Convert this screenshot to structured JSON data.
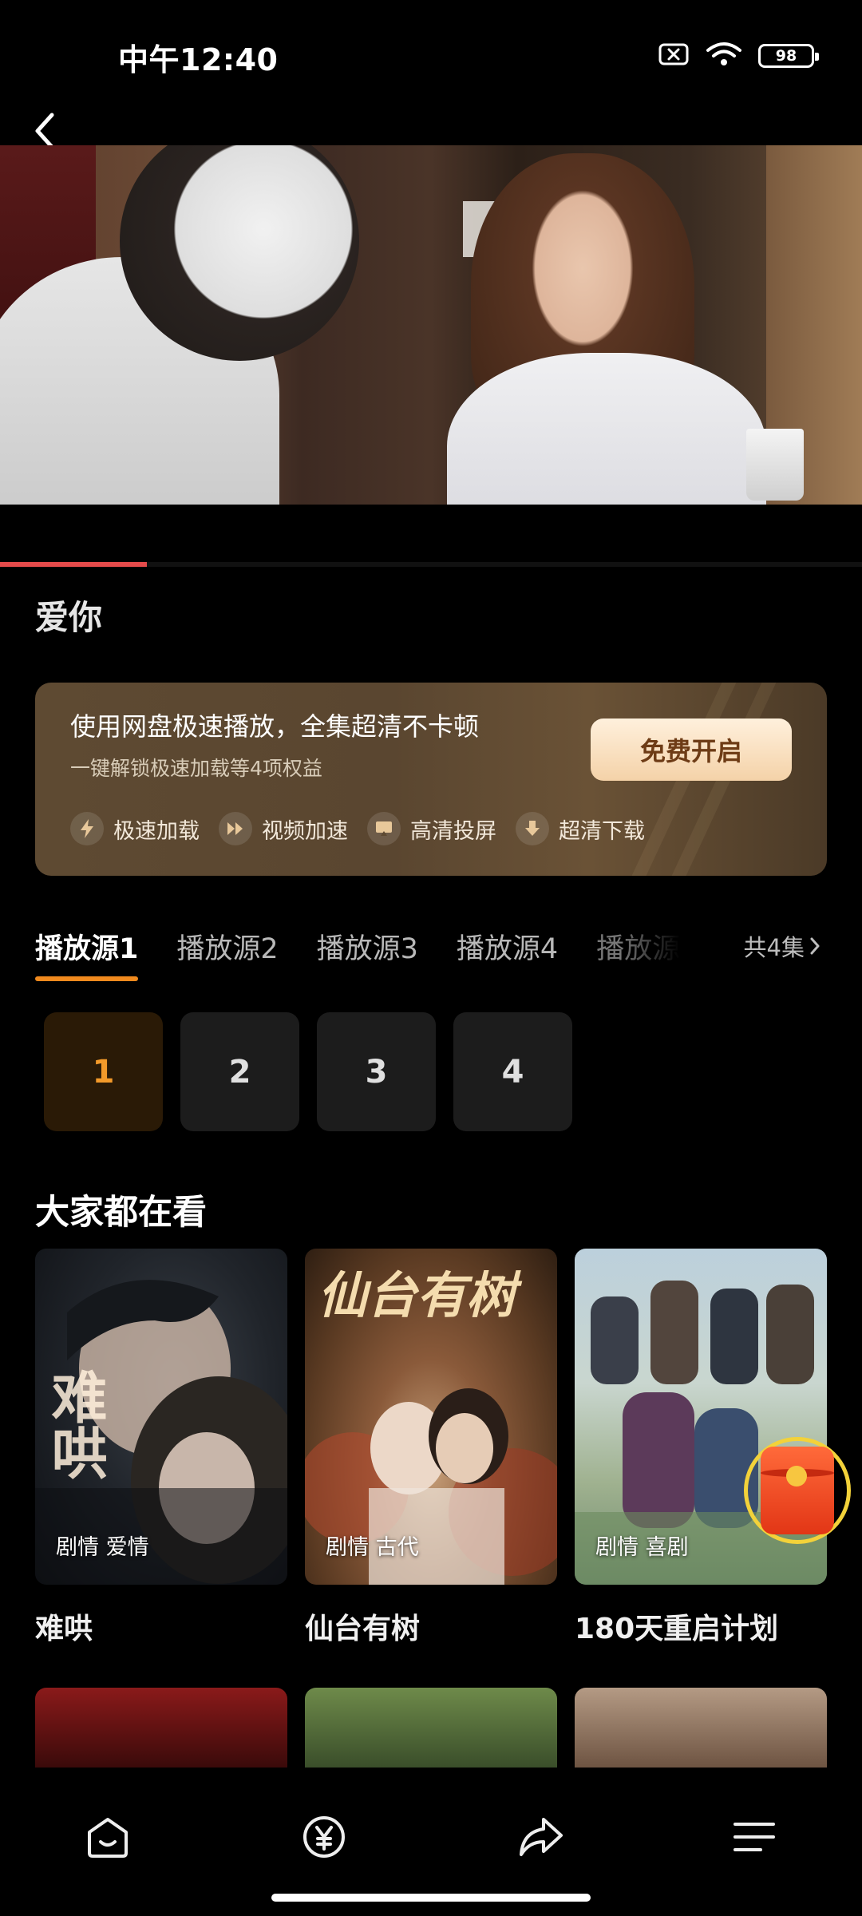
{
  "status_bar": {
    "time": "中午12:40",
    "battery": "98"
  },
  "video": {
    "progress_percent": 17
  },
  "title": "爱你",
  "promo": {
    "title": "使用网盘极速播放，全集超清不卡顿",
    "subtitle": "一键解锁极速加载等4项权益",
    "button": "免费开启",
    "perks": [
      "极速加载",
      "视频加速",
      "高清投屏",
      "超清下载"
    ]
  },
  "sources": {
    "tabs": [
      "播放源1",
      "播放源2",
      "播放源3",
      "播放源4",
      "播放源"
    ],
    "active_index": 0,
    "episode_count": "共4集"
  },
  "episodes": [
    "1",
    "2",
    "3",
    "4"
  ],
  "recommend": {
    "title": "大家都在看",
    "items": [
      {
        "title": "难哄",
        "tags": "剧情 爱情"
      },
      {
        "title": "仙台有树",
        "tags": "剧情 古代"
      },
      {
        "title": "180天重启计划",
        "tags": "剧情 喜剧"
      }
    ]
  },
  "colors": {
    "accent": "#f08a1e",
    "progress": "#e54b4b",
    "promo_bg": "#5e4a32"
  }
}
